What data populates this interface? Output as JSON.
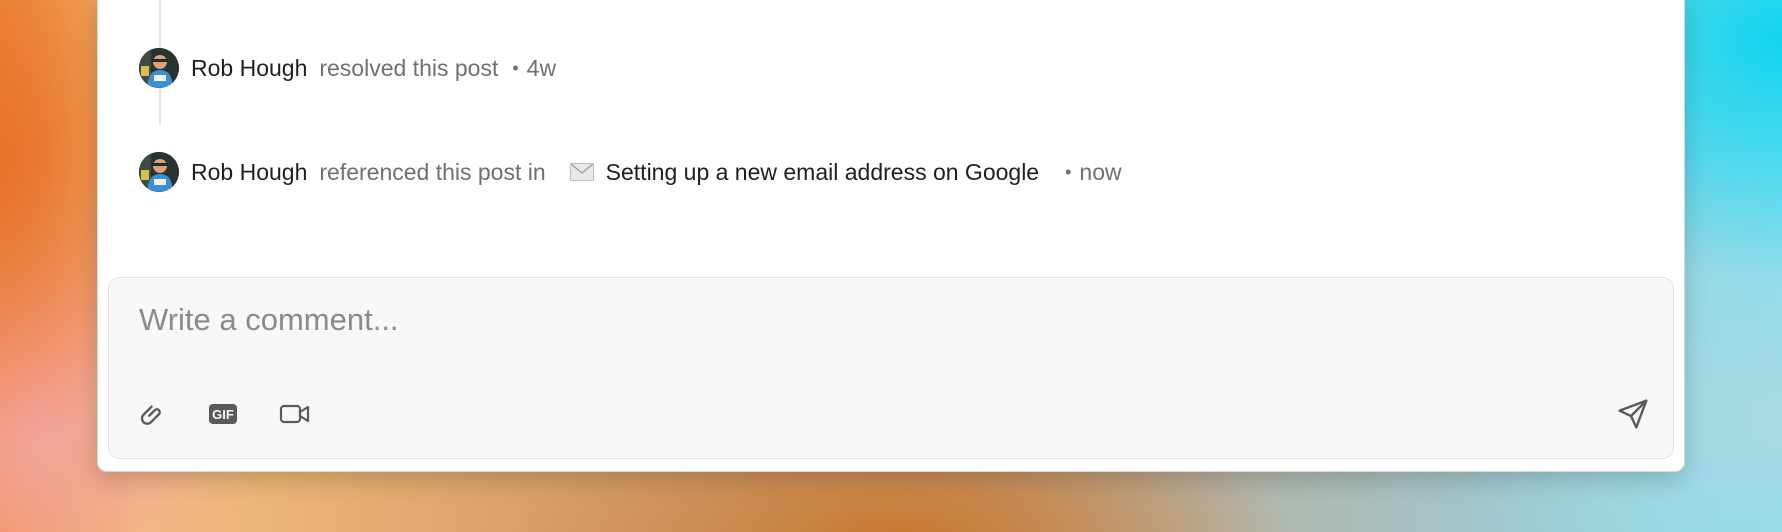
{
  "activity": [
    {
      "author": "Rob Hough",
      "verb": "resolved this post",
      "separator": "•",
      "time": "4w"
    },
    {
      "author": "Rob Hough",
      "verb": "referenced this post in",
      "reference_icon": "envelope-icon",
      "reference_title": "Setting up a new email address on Google",
      "separator": "•",
      "time": "now"
    }
  ],
  "composer": {
    "placeholder": "Write a comment...",
    "value": "",
    "tools": [
      {
        "name": "attach",
        "icon": "paperclip-icon"
      },
      {
        "name": "gif",
        "icon": "gif-icon",
        "label": "GIF"
      },
      {
        "name": "video",
        "icon": "video-camera-icon"
      }
    ],
    "send_icon": "paper-plane-icon"
  },
  "colors": {
    "text_primary": "#1f1f1f",
    "text_secondary": "#707070",
    "composer_bg": "#f8f8f8",
    "icon": "#5a5a5a"
  }
}
